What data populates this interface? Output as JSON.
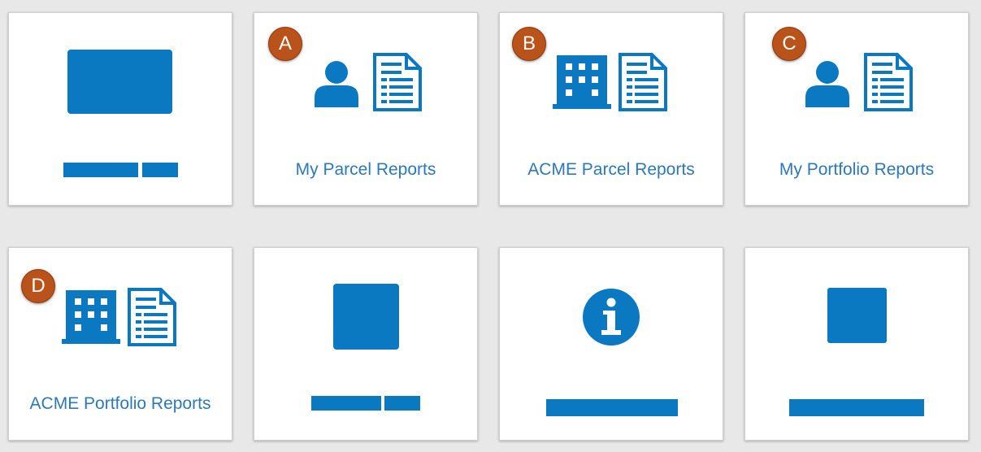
{
  "theme": {
    "accent": "#0b78c2",
    "label_color": "#2b78bb",
    "badge_color": "#b9531a",
    "background": "#e8e8e8"
  },
  "tiles": [
    {
      "id": 1,
      "icon": "placeholder-rectangle-icon",
      "label": "",
      "badge": ""
    },
    {
      "id": 2,
      "icon": [
        "person-icon",
        "report-document-icon"
      ],
      "label": "My Parcel Reports",
      "badge": "A"
    },
    {
      "id": 3,
      "icon": [
        "building-icon",
        "report-document-icon"
      ],
      "label": "ACME Parcel Reports",
      "badge": "B"
    },
    {
      "id": 4,
      "icon": [
        "person-icon",
        "report-document-icon"
      ],
      "label": "My Portfolio Reports",
      "badge": "C"
    },
    {
      "id": 5,
      "icon": [
        "building-icon",
        "report-document-icon"
      ],
      "label": "ACME Portfolio Reports",
      "badge": "D"
    },
    {
      "id": 6,
      "icon": "placeholder-square-icon",
      "label": "",
      "badge": ""
    },
    {
      "id": 7,
      "icon": "info-icon",
      "label": "",
      "badge": ""
    },
    {
      "id": 8,
      "icon": "placeholder-square-icon",
      "label": "",
      "badge": ""
    }
  ]
}
